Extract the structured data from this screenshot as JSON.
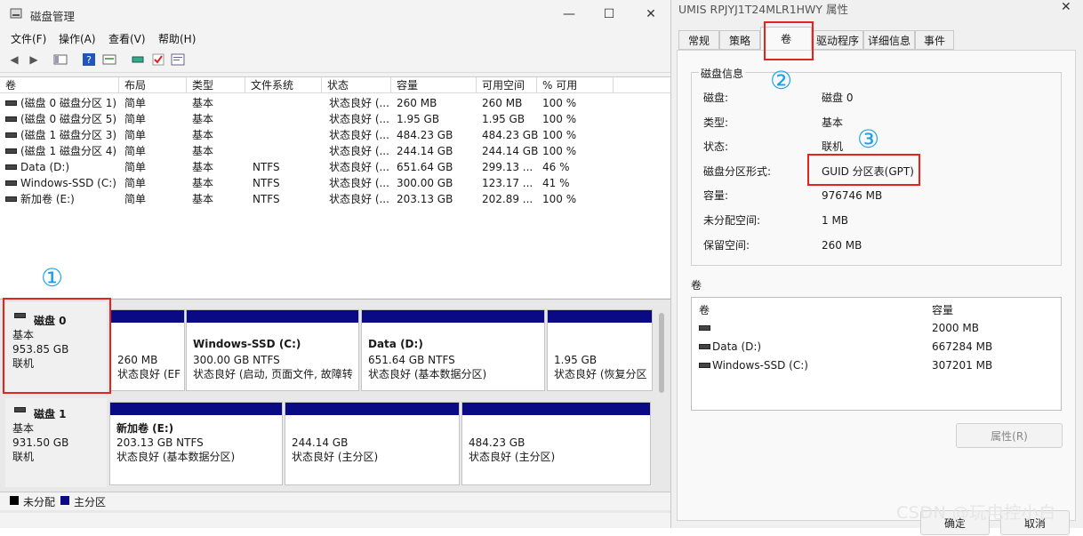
{
  "disk_management": {
    "title": "磁盘管理",
    "window_controls": {
      "minimize": "—",
      "maximize": "☐",
      "close": "✕"
    },
    "menu": [
      "文件(F)",
      "操作(A)",
      "查看(V)",
      "帮助(H)"
    ],
    "columns": [
      "卷",
      "布局",
      "类型",
      "文件系统",
      "状态",
      "容量",
      "可用空间",
      "% 可用"
    ],
    "rows": [
      [
        "(磁盘 0 磁盘分区 1)",
        "简单",
        "基本",
        "",
        "状态良好 (...",
        "260 MB",
        "260 MB",
        "100 %"
      ],
      [
        "(磁盘 0 磁盘分区 5)",
        "简单",
        "基本",
        "",
        "状态良好 (...",
        "1.95 GB",
        "1.95 GB",
        "100 %"
      ],
      [
        "(磁盘 1 磁盘分区 3)",
        "简单",
        "基本",
        "",
        "状态良好 (...",
        "484.23 GB",
        "484.23 GB",
        "100 %"
      ],
      [
        "(磁盘 1 磁盘分区 4)",
        "简单",
        "基本",
        "",
        "状态良好 (...",
        "244.14 GB",
        "244.14 GB",
        "100 %"
      ],
      [
        "Data (D:)",
        "简单",
        "基本",
        "NTFS",
        "状态良好 (...",
        "651.64 GB",
        "299.13 ...",
        "46 %"
      ],
      [
        "Windows-SSD (C:)",
        "简单",
        "基本",
        "NTFS",
        "状态良好 (...",
        "300.00 GB",
        "123.17 ...",
        "41 %"
      ],
      [
        "新加卷 (E:)",
        "简单",
        "基本",
        "NTFS",
        "状态良好 (...",
        "203.13 GB",
        "202.89 ...",
        "100 %"
      ]
    ],
    "disks": [
      {
        "name": "磁盘 0",
        "type": "基本",
        "size": "953.85 GB",
        "status": "联机",
        "partitions": [
          {
            "name": "",
            "size": "260 MB",
            "status": "状态良好 (EF"
          },
          {
            "name": "Windows-SSD  (C:)",
            "size": "300.00 GB NTFS",
            "status": "状态良好 (启动, 页面文件, 故障转"
          },
          {
            "name": "Data  (D:)",
            "size": "651.64 GB NTFS",
            "status": "状态良好 (基本数据分区)"
          },
          {
            "name": "",
            "size": "1.95 GB",
            "status": "状态良好 (恢复分区"
          }
        ]
      },
      {
        "name": "磁盘 1",
        "type": "基本",
        "size": "931.50 GB",
        "status": "联机",
        "partitions": [
          {
            "name": "新加卷  (E:)",
            "size": "203.13 GB NTFS",
            "status": "状态良好 (基本数据分区)"
          },
          {
            "name": "",
            "size": "244.14 GB",
            "status": "状态良好 (主分区)"
          },
          {
            "name": "",
            "size": "484.23 GB",
            "status": "状态良好 (主分区)"
          }
        ]
      }
    ],
    "legend": {
      "unallocated": "未分配",
      "primary": "主分区"
    }
  },
  "properties": {
    "title": "UMIS RPJYJ1T24MLR1HWY 属性",
    "close": "✕",
    "tabs": [
      "常规",
      "策略",
      "卷",
      "驱动程序",
      "详细信息",
      "事件"
    ],
    "active_tab": "卷",
    "group_title": "磁盘信息",
    "info": [
      {
        "label": "磁盘:",
        "value": "磁盘 0"
      },
      {
        "label": "类型:",
        "value": "基本"
      },
      {
        "label": "状态:",
        "value": "联机"
      },
      {
        "label": "磁盘分区形式:",
        "value": "GUID 分区表(GPT)"
      },
      {
        "label": "容量:",
        "value": "976746 MB"
      },
      {
        "label": "未分配空间:",
        "value": "1 MB"
      },
      {
        "label": "保留空间:",
        "value": "260 MB"
      }
    ],
    "volumes_label": "卷",
    "volumes_columns": [
      "卷",
      "容量"
    ],
    "volumes": [
      {
        "name": "",
        "size": "2000 MB"
      },
      {
        "name": "Data (D:)",
        "size": "667284 MB"
      },
      {
        "name": "Windows-SSD (C:)",
        "size": "307201 MB"
      }
    ],
    "properties_button": "属性(R)",
    "ok_button": "确定",
    "cancel_button": "取消"
  },
  "annotations": {
    "one": "①",
    "two": "②",
    "three": "③"
  },
  "watermark": "CSDN @玩电控小白",
  "colors": {
    "primary_partition": "#0a0a84",
    "annotation_box": "#e3231c",
    "annotation_number": "#1aa0e6"
  }
}
